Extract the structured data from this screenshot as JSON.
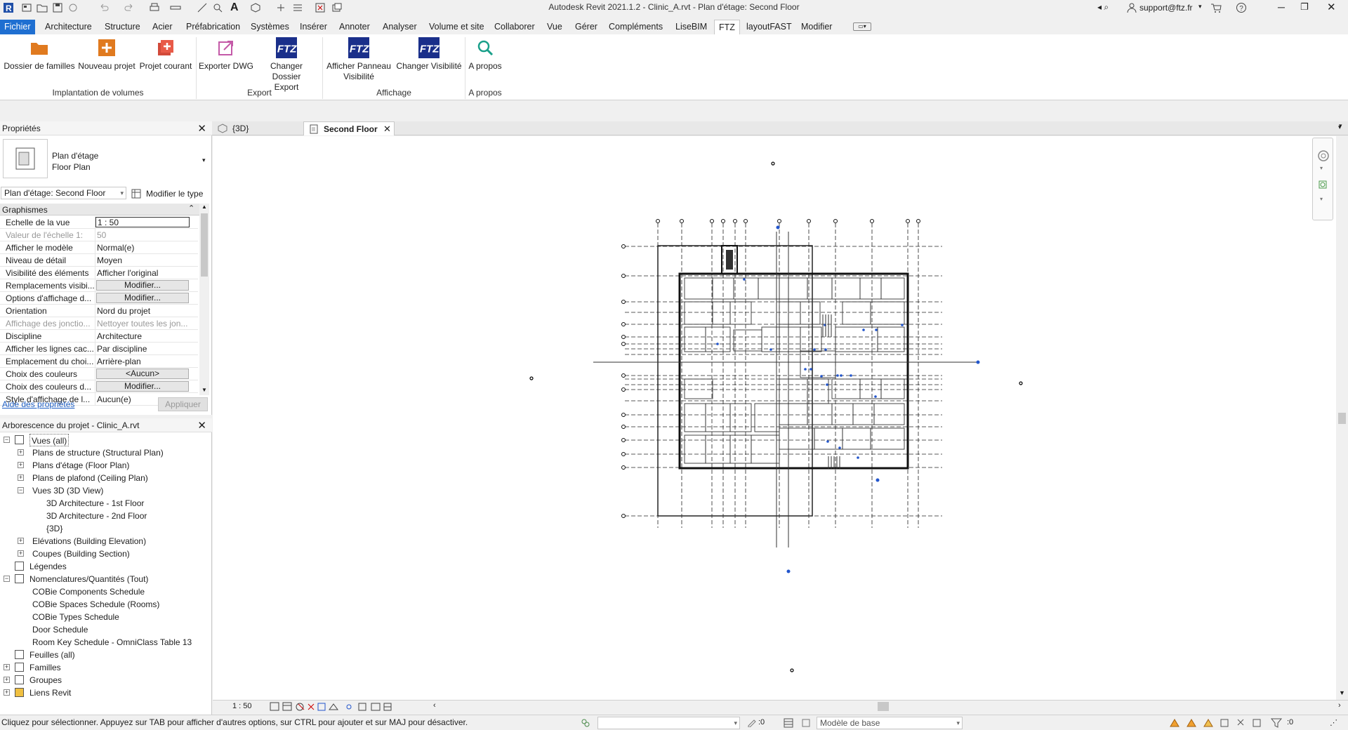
{
  "window": {
    "title": "Autodesk Revit 2021.1.2 - Clinic_A.rvt - Plan d'étage: Second Floor",
    "user": "support@ftz.fr"
  },
  "tabs": [
    "Fichier",
    "Architecture",
    "Structure",
    "Acier",
    "Préfabrication",
    "Systèmes",
    "Insérer",
    "Annoter",
    "Analyser",
    "Volume et site",
    "Collaborer",
    "Vue",
    "Gérer",
    "Compléments",
    "LiseBIM",
    "FTZ",
    "layoutFAST",
    "Modifier"
  ],
  "active_tab": "FTZ",
  "ribbon": {
    "buttons": {
      "dossier_familles": "Dossier de familles",
      "nouveau_projet": "Nouveau projet",
      "projet_courant": "Projet courant",
      "exporter_dwg": "Exporter DWG",
      "changer_dossier_1": "Changer Dossier",
      "changer_dossier_2": "Export",
      "afficher_panneau_1": "Afficher Panneau",
      "afficher_panneau_2": "Visibilité",
      "changer_visibilite": "Changer Visibilité",
      "a_propos": "A propos"
    },
    "groups": {
      "implantation": "Implantation de volumes",
      "export": "Export",
      "affichage": "Affichage",
      "apropos": "A propos"
    },
    "ftz_logo": "FTZ"
  },
  "properties": {
    "title": "Propriétés",
    "type_line1": "Plan d'étage",
    "type_line2": "Floor Plan",
    "instance_selector": "Plan d'étage: Second Floor",
    "edit_type": "Modifier le type",
    "section": "Graphismes",
    "rows": [
      {
        "k": "Echelle de la vue",
        "v": "1 : 50"
      },
      {
        "k": "Valeur de l'échelle    1:",
        "v": "50"
      },
      {
        "k": "Afficher le modèle",
        "v": "Normal(e)"
      },
      {
        "k": "Niveau de détail",
        "v": "Moyen"
      },
      {
        "k": "Visibilité des éléments",
        "v": "Afficher l'original"
      },
      {
        "k": "Remplacements visibi...",
        "v": "Modifier..."
      },
      {
        "k": "Options d'affichage d...",
        "v": "Modifier..."
      },
      {
        "k": "Orientation",
        "v": "Nord du projet"
      },
      {
        "k": "Affichage des jonctio...",
        "v": "Nettoyer toutes les jon..."
      },
      {
        "k": "Discipline",
        "v": "Architecture"
      },
      {
        "k": "Afficher les lignes cac...",
        "v": "Par discipline"
      },
      {
        "k": "Emplacement du choi...",
        "v": "Arrière-plan"
      },
      {
        "k": "Choix des couleurs",
        "v": "<Aucun>"
      },
      {
        "k": "Choix des couleurs d...",
        "v": "Modifier..."
      },
      {
        "k": "Style d'affichage de l...",
        "v": "Aucun(e)"
      }
    ],
    "help_link": "Aide des propriétés",
    "apply": "Appliquer"
  },
  "browser": {
    "title": "Arborescence du projet - Clinic_A.rvt",
    "nodes": [
      {
        "label": "Vues (all)",
        "level": 0,
        "exp": "-"
      },
      {
        "label": "Plans de structure (Structural Plan)",
        "level": 1,
        "exp": "+"
      },
      {
        "label": "Plans d'étage (Floor Plan)",
        "level": 1,
        "exp": "+"
      },
      {
        "label": "Plans de plafond (Ceiling Plan)",
        "level": 1,
        "exp": "+"
      },
      {
        "label": "Vues 3D (3D View)",
        "level": 1,
        "exp": "-"
      },
      {
        "label": "3D Architecture - 1st Floor",
        "level": 2,
        "exp": ""
      },
      {
        "label": "3D Architecture - 2nd Floor",
        "level": 2,
        "exp": ""
      },
      {
        "label": "{3D}",
        "level": 2,
        "exp": ""
      },
      {
        "label": "Elévations (Building Elevation)",
        "level": 1,
        "exp": "+"
      },
      {
        "label": "Coupes (Building Section)",
        "level": 1,
        "exp": "+"
      },
      {
        "label": "Légendes",
        "level": 0,
        "exp": ""
      },
      {
        "label": "Nomenclatures/Quantités (Tout)",
        "level": 0,
        "exp": "-"
      },
      {
        "label": "COBie Components Schedule",
        "level": 1,
        "exp": ""
      },
      {
        "label": "COBie Spaces Schedule (Rooms)",
        "level": 1,
        "exp": ""
      },
      {
        "label": "COBie Types Schedule",
        "level": 1,
        "exp": ""
      },
      {
        "label": "Door Schedule",
        "level": 1,
        "exp": ""
      },
      {
        "label": "Room Key Schedule - OmniClass Table 13",
        "level": 1,
        "exp": ""
      },
      {
        "label": "Feuilles (all)",
        "level": 0,
        "exp": ""
      },
      {
        "label": "Familles",
        "level": 0,
        "exp": "+"
      },
      {
        "label": "Groupes",
        "level": 0,
        "exp": "+"
      },
      {
        "label": "Liens Revit",
        "level": 0,
        "exp": "+"
      }
    ]
  },
  "view_tabs": [
    {
      "label": "{3D}"
    },
    {
      "label": "Second Floor"
    }
  ],
  "view_control": {
    "scale": "1 : 50"
  },
  "status": {
    "message": "Cliquez pour sélectionner. Appuyez sur TAB pour afficher d'autres options, sur CTRL pour ajouter et sur MAJ pour désactiver.",
    "selection_count": ":0",
    "model": "Modèle de base",
    "filter_count": ":0"
  },
  "colors": {
    "accent": "#1f6fd1",
    "file_tab": "#1f6fd1",
    "ftz_blue": "#1a2f8a",
    "orange": "#e07a1f",
    "red": "#d24a3a",
    "grid_blue": "#2255cc"
  }
}
